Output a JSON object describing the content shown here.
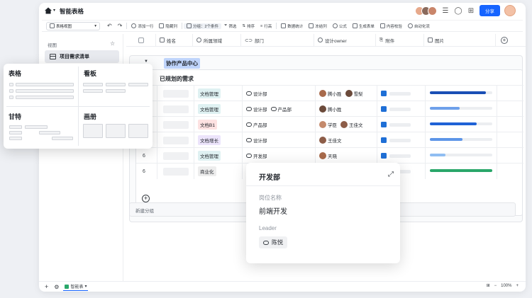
{
  "app": {
    "title": "智能表格",
    "share_label": "分享"
  },
  "toolbar": {
    "view_name": "表格视图",
    "items": [
      "添加一行",
      "隐藏列",
      "分组：2个条件",
      "筛选",
      "排序",
      "行高",
      "数据统计",
      "冻结列",
      "公式",
      "生成表单",
      "内容校验",
      "自动化流"
    ]
  },
  "sidebar": {
    "header": "视图",
    "active_item": "项目需求清单"
  },
  "columns": [
    "姓名",
    "所属领域",
    "部门",
    "设计owner",
    "附件",
    "图片"
  ],
  "group1": {
    "label": "协作产品中心"
  },
  "group2": {
    "label": "已规划的需求"
  },
  "rows": [
    {
      "num": "",
      "tag": "文档管理",
      "tag_color": "#dff1f2",
      "depts": [
        "设计部"
      ],
      "owners": [
        "腾小胜",
        "雪梨"
      ],
      "progress": 0.9,
      "prog_color": "#1a4fb5"
    },
    {
      "num": "",
      "tag": "文档管理",
      "tag_color": "#dff1f2",
      "depts": [
        "设计部",
        "产品部"
      ],
      "owners": [
        "腾小胜"
      ],
      "progress": 0.48,
      "prog_color": "#6ea0ea"
    },
    {
      "num": "",
      "tag": "文档B1",
      "tag_color": "#fde2e2",
      "depts": [
        "产品部"
      ],
      "owners": [
        "学臣",
        "王佳文"
      ],
      "progress": 0.75,
      "prog_color": "#1f62d6"
    },
    {
      "num": "",
      "tag": "文档增长",
      "tag_color": "#ece4fb",
      "depts": [
        "设计部"
      ],
      "owners": [
        "王佳文"
      ],
      "progress": 0.52,
      "prog_color": "#5d95e8"
    },
    {
      "num": "6",
      "tag": "文档管理",
      "tag_color": "#dff1f2",
      "depts": [
        "开发部"
      ],
      "owners": [
        "天晓"
      ],
      "progress": 0.25,
      "prog_color": "#90bdf2"
    },
    {
      "num": "6",
      "tag": "商业化",
      "tag_color": "#ededed",
      "depts": [],
      "owners": [],
      "progress": 1.0,
      "prog_color": "#2aa76a"
    }
  ],
  "new_group_label": "新建分组",
  "views": {
    "table": "表格",
    "kanban": "看板",
    "gantt": "甘特",
    "gallery": "画册"
  },
  "popup": {
    "title": "开发部",
    "field1_label": "岗位名称",
    "field1_value": "前端开发",
    "field2_label": "Leader",
    "field2_value": "陈悦"
  },
  "bottom": {
    "sheet_name": "智能表",
    "zoom": "100%"
  }
}
